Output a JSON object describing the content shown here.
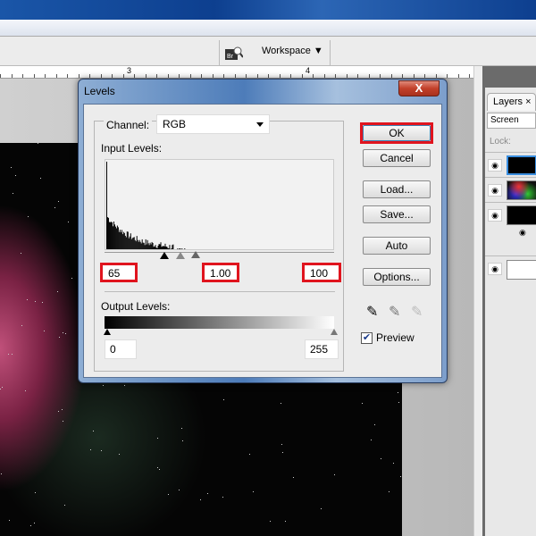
{
  "toolbar": {
    "workspace_label": "Workspace ▼",
    "bridge_icon": "bridge-icon"
  },
  "ruler": {
    "labels": [
      "3",
      "4"
    ]
  },
  "layers_panel": {
    "tab_label": "Layers ×",
    "blend_mode": "Screen",
    "lock_label": "Lock:"
  },
  "dialog": {
    "title": "Levels",
    "close_label": "X",
    "channel_label": "Channel:",
    "channel_value": "RGB",
    "input_levels_label": "Input Levels:",
    "input_black": "65",
    "input_gamma": "1.00",
    "input_white": "100",
    "output_levels_label": "Output Levels:",
    "output_black": "0",
    "output_white": "255",
    "buttons": {
      "ok": "OK",
      "cancel": "Cancel",
      "load": "Load...",
      "save": "Save...",
      "auto": "Auto",
      "options": "Options..."
    },
    "preview_label": "Preview",
    "preview_checked": true,
    "highlight_color": "#e0141e"
  }
}
